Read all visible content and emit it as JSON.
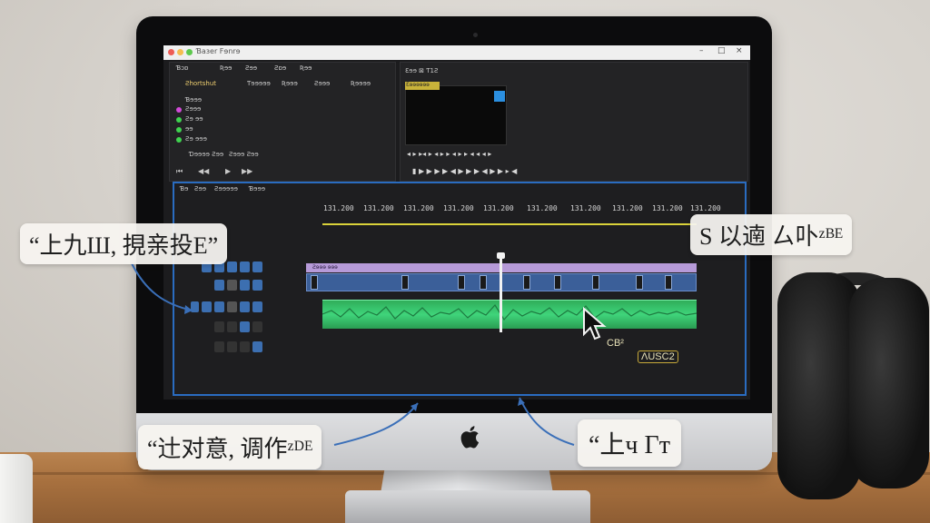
{
  "app": {
    "window_title": "Ɓaзer Fɘnrɘ",
    "window_controls": [
      "–",
      "□",
      "×"
    ],
    "menu_row1": [
      "Ɓɔɒ",
      "Ʀɘɘ",
      "Ƨɘɘ",
      "Ƨɒɘ",
      "Ʀɘɘ"
    ],
    "menu_row2": [
      "Ƨhortshut",
      "Ƭɘɘɘɘɘ",
      "Ʀɘɘɘ",
      "Ƨɘɘɘ",
      "Ʀɘɘɘɘ"
    ],
    "media_list": [
      "Ɓɘɘɘ",
      "Ƨɘɘɘ",
      "Ƨɘ ɘɘ",
      "ɘɘ",
      "Ƨɘ ɘɘɘ"
    ],
    "media_list_colors": [
      "#d24ad9",
      "#3fd24f",
      "#3fd24f",
      "#3fd24f"
    ],
    "panel_footer": [
      "Ɗɘɘɘɘ Ƨɘɘ",
      "Ƨɘɘɘ Ƨɘɘ"
    ],
    "preview_tab": "Ɛɘɘ  ⊠ Ƭ1Ƨ",
    "preview_tag_text": "Ɛɘɘɘɘɘɘ",
    "timeline_tabs": [
      "Ɓɘ",
      "Ƨɘɘ",
      "Ƨɘɘɘɘɘ",
      "Ɓɘɘɘ"
    ],
    "ruler_labels": [
      "131.200",
      "131.200",
      "131.200",
      "131.200",
      "131.200",
      "131.200",
      "131.200",
      "131.200",
      "131.200",
      "131.200"
    ],
    "video_clip_label": "Ƨɘɘɘ ɘɘɘ",
    "clip_tag_1": "CB²",
    "clip_tag_2": "ΛUSC2",
    "accent": "#2a6cc0",
    "audio_color": "#3fd47a",
    "video_color": "#3b5f99"
  },
  "callouts": {
    "left": "“上九Ш, 挸亲投E”",
    "right": "S 以遖 ㄙ卟ᶻᴮᴱ",
    "bottom_left": "“辻对意, 调作ᶻᴰᴱ",
    "bottom_right": "“上ч Гт"
  },
  "icons": [
    "apple-logo-icon",
    "mouse-cursor-icon",
    "play-icon",
    "rewind-icon",
    "forward-icon",
    "headphones-icon"
  ]
}
